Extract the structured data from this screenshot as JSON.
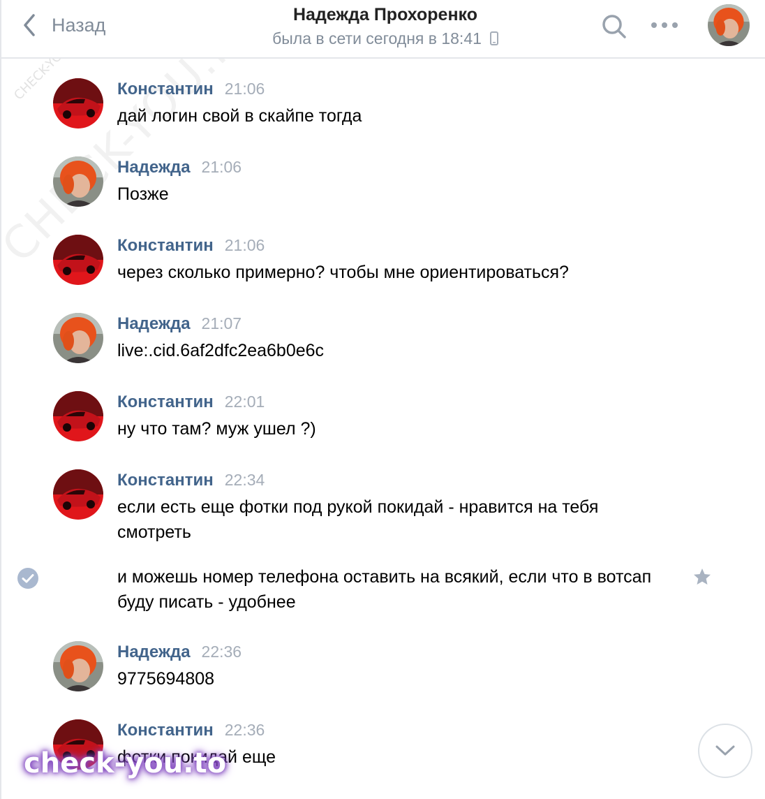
{
  "header": {
    "back_label": "Назад",
    "peer_name": "Надежда Прохоренко",
    "peer_status": "была в сети сегодня в 18:41"
  },
  "messages": [
    {
      "author": "Константин",
      "time": "21:06",
      "text": "дай логин свой в скайпе тогда",
      "avatar": "car"
    },
    {
      "author": "Надежда",
      "time": "21:06",
      "text": "Позже",
      "avatar": "woman"
    },
    {
      "author": "Константин",
      "time": "21:06",
      "text": "через сколько примерно? чтобы мне ориентироваться?",
      "avatar": "car"
    },
    {
      "author": "Надежда",
      "time": "21:07",
      "text": "live:.cid.6af2dfc2ea6b0e6c",
      "avatar": "woman"
    },
    {
      "author": "Константин",
      "time": "22:01",
      "text": "ну что там? муж ушел ?)",
      "avatar": "car"
    },
    {
      "author": "Константин",
      "time": "22:34",
      "text": "если есть еще фотки под рукой покидай - нравится на тебя смотреть",
      "avatar": "car"
    },
    {
      "author": "",
      "time": "",
      "text": "и можешь номер телефона оставить на всякий, если что в вотсап буду писать - удобнее",
      "avatar": "",
      "selected": true
    },
    {
      "author": "Надежда",
      "time": "22:36",
      "text": "9775694808",
      "avatar": "woman"
    },
    {
      "author": "Константин",
      "time": "22:36",
      "text": "фотки покидай еще",
      "avatar": "car"
    }
  ],
  "watermarks": {
    "diagonal": "CHECK-YOU.ME",
    "small": "CHECK-YOU.ME",
    "bottom": "check-you.to"
  },
  "icons": {
    "back": "chevron-left-icon",
    "search": "search-icon",
    "more": "more-dots-icon",
    "phone": "mobile-phone-icon",
    "selected": "check-circle-icon",
    "star": "star-icon",
    "scroll": "chevron-down-icon"
  },
  "colors": {
    "author": "#42648b",
    "time": "#a5adb8",
    "muted": "#818c99",
    "check": "#a9b8cf",
    "car_red": "#e0161b"
  }
}
